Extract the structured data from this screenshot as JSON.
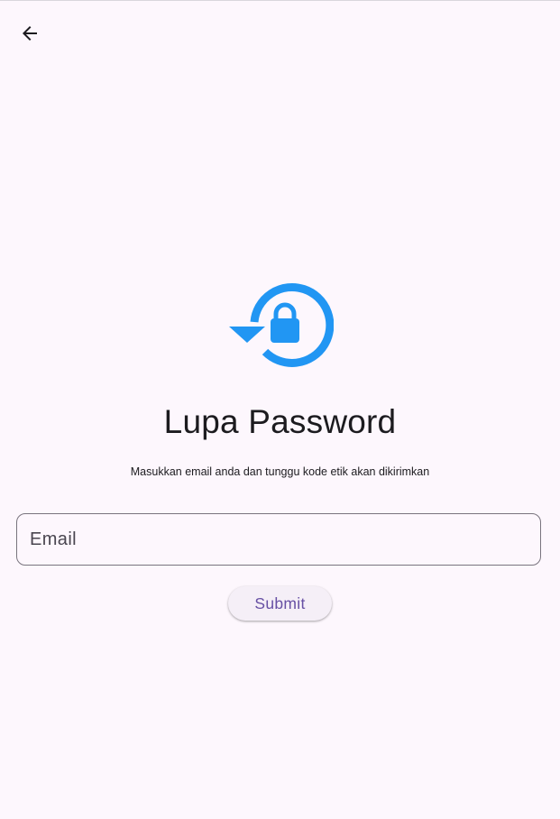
{
  "header": {
    "back_icon": "arrow-back-icon"
  },
  "hero": {
    "icon": "lock-reset-icon",
    "icon_color": "#2196f3"
  },
  "content": {
    "title": "Lupa Password",
    "subtitle": "Masukkan email anda dan tunggu kode etik akan dikirimkan"
  },
  "form": {
    "email_placeholder": "Email",
    "email_value": "",
    "submit_label": "Submit"
  },
  "colors": {
    "background": "#fdf7fd",
    "accent": "#6750a4",
    "icon": "#2196f3",
    "outline": "#79747e"
  }
}
